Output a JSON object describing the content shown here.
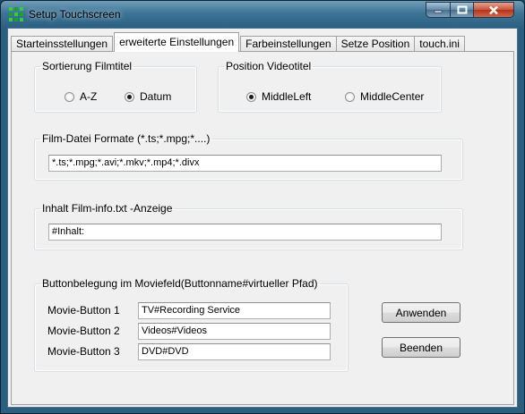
{
  "window": {
    "title": "Setup Touchscreen",
    "icon": "app-grid-icon"
  },
  "tabs": [
    "Starteinsstellungen",
    "erweiterte Einstellungen",
    "Farbeinstellungen",
    "Setze Position",
    "touch.ini"
  ],
  "active_tab": "erweiterte Einstellungen",
  "sortierung": {
    "legend": "Sortierung Filmtitel",
    "options": [
      "A-Z",
      "Datum"
    ],
    "selected": "Datum"
  },
  "position": {
    "legend": "Position Videotitel",
    "options": [
      "MiddleLeft",
      "MiddleCenter"
    ],
    "selected": "MiddleLeft"
  },
  "formate": {
    "legend": "Film-Datei Formate (*.ts;*.mpg;*....)",
    "value": "*.ts;*.mpg;*.avi;*.mkv;*.mp4;*.divx"
  },
  "inhalt": {
    "legend": "Inhalt Film-info.txt -Anzeige",
    "value": "#Inhalt:"
  },
  "buttons_group": {
    "legend": "Buttonbelegung im Moviefeld(Buttonname#virtueller Pfad)",
    "rows": [
      {
        "label": "Movie-Button 1",
        "value": "TV#Recording Service"
      },
      {
        "label": "Movie-Button 2",
        "value": "Videos#Videos"
      },
      {
        "label": "Movie-Button 3",
        "value": "DVD#DVD"
      }
    ]
  },
  "actions": {
    "apply": "Anwenden",
    "exit": "Beenden"
  }
}
